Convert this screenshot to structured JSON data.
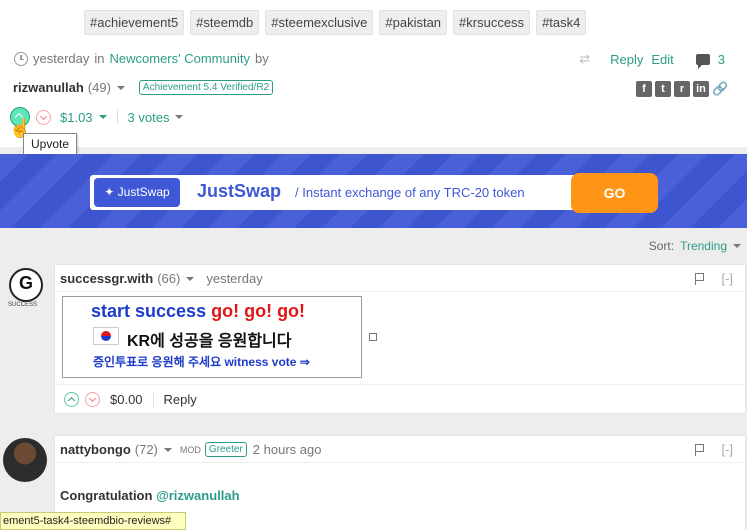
{
  "post": {
    "tags": [
      "#achievement5",
      "#steemdb",
      "#steemexclusive",
      "#pakistan",
      "#krsuccess",
      "#task4"
    ],
    "time": "yesterday",
    "in_word": "in",
    "community": "Newcomers' Community",
    "by_word": "by",
    "actions": {
      "reply": "Reply",
      "edit": "Edit",
      "comment_count": "3"
    },
    "author": {
      "name": "rizwanullah",
      "rep": "(49)",
      "badge": "Achievement 5.4 Verified/R2"
    },
    "payout": "$1.03",
    "votes": "3 votes",
    "share": [
      "f",
      "t",
      "r",
      "in"
    ],
    "tooltip": "Upvote"
  },
  "banner": {
    "logo": "✦ JustSwap",
    "title": "JustSwap",
    "tagline": "/ Instant exchange of any TRC-20 token",
    "button": "GO"
  },
  "sort": {
    "label": "Sort:",
    "value": "Trending"
  },
  "comments": [
    {
      "author": "successgr.with",
      "rep": "(66)",
      "time": "yesterday",
      "avatar_label": "SUCCESS",
      "image": {
        "line1_blue": "start success",
        "line1_red": "go! go! go!",
        "line2": "KR에 성공을 응원합니다",
        "line3": "증인투표로 응원해 주세요 witness vote ⇒"
      },
      "payout": "$0.00",
      "reply": "Reply",
      "collapse": "[-]"
    },
    {
      "author": "nattybongo",
      "rep": "(72)",
      "role": "MOD",
      "badge": "Greeter",
      "time": "2 hours ago",
      "body_text": "Congratulation",
      "mention": "@rizwanullah",
      "collapse": "[-]"
    }
  ],
  "status_url": "ement5-task4-steemdbio-reviews#",
  "colors": {
    "accent": "#2c9c88",
    "banner": "#3f58d6",
    "go": "#ff9416"
  }
}
